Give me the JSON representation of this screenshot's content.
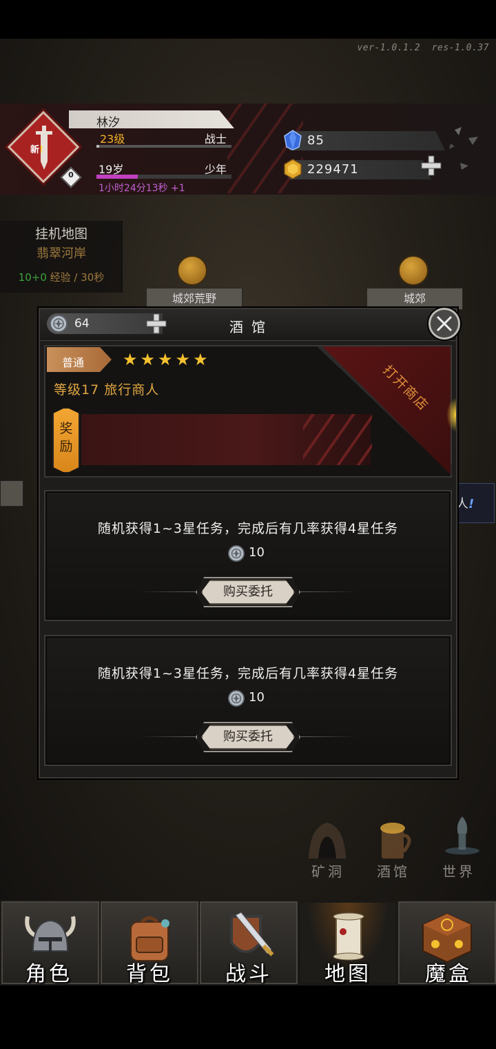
{
  "version": {
    "ver": "ver-1.0.1.2",
    "res": "res-1.0.37"
  },
  "player": {
    "name": "林汐",
    "level": "23级",
    "class": "战士",
    "age": "19岁",
    "stage": "少年",
    "timer": "1小时24分13秒 +1",
    "new_badge": "新",
    "new_badge_mark": "!",
    "emblem_count": "0"
  },
  "resources": {
    "gems": "85",
    "gold": "229471"
  },
  "map_panel": {
    "title": "挂机地图",
    "place": "翡翠河岸",
    "rate_gain": "10+0",
    "rate_rest": " 经验 / 30秒"
  },
  "map_nodes": [
    {
      "label": "城郊荒野"
    },
    {
      "label": "城郊"
    }
  ],
  "side_tab_right": {
    "text": "人",
    "mark": "!"
  },
  "modal": {
    "coins": "64",
    "title": "酒馆",
    "merchant": {
      "rarity": "普通",
      "stars": "★★★★★",
      "star_count": 5,
      "description": "等级17 旅行商人",
      "reward_label": "奖励",
      "open_shop": "打开商店"
    },
    "tasks": [
      {
        "description": "随机获得1~3星任务，完成后有几率获得4星任务",
        "cost": "10",
        "button": "购买委托"
      },
      {
        "description": "随机获得1~3星任务，完成后有几率获得4星任务",
        "cost": "10",
        "button": "购买委托"
      }
    ]
  },
  "locations": [
    {
      "label": "矿洞",
      "icon": "mine-icon"
    },
    {
      "label": "酒馆",
      "icon": "tavern-icon"
    },
    {
      "label": "世界",
      "icon": "world-icon"
    }
  ],
  "nav": [
    {
      "label": "角色",
      "icon": "helmet-icon"
    },
    {
      "label": "背包",
      "icon": "backpack-icon"
    },
    {
      "label": "战斗",
      "icon": "sword-shield-icon"
    },
    {
      "label": "地图",
      "icon": "scroll-icon",
      "active": true
    },
    {
      "label": "魔盒",
      "icon": "magic-box-icon"
    }
  ],
  "colors": {
    "gold_text": "#e2a742",
    "level_text": "#f0b22a",
    "timer_text": "#c060d0",
    "emblem_red": "#a92222",
    "reward_orange": "#f3a633"
  }
}
